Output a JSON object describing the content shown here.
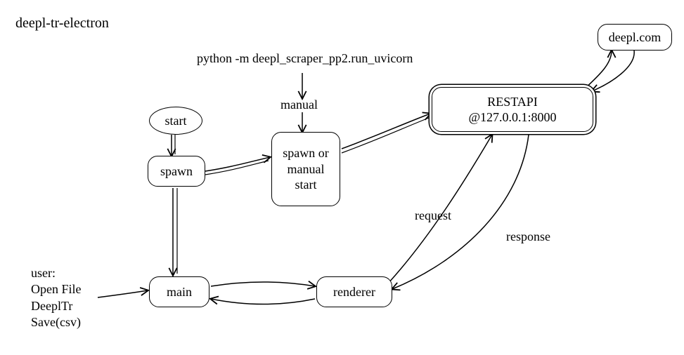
{
  "title": "deepl-tr-electron",
  "command": "python -m deepl_scraper_pp2.run_uvicorn",
  "labels": {
    "manual": "manual",
    "request": "request",
    "response": "response",
    "user_actions": "user:\nOpen File\nDeeplTr\nSave(csv)"
  },
  "nodes": {
    "start": "start",
    "spawn": "spawn",
    "spawn_or_manual": "spawn\nor\nmanual\nstart",
    "restapi_line1": "RESTAPI",
    "restapi_line2": "@127.0.0.1:8000",
    "deepl": "deepl.com",
    "main": "main",
    "renderer": "renderer"
  }
}
